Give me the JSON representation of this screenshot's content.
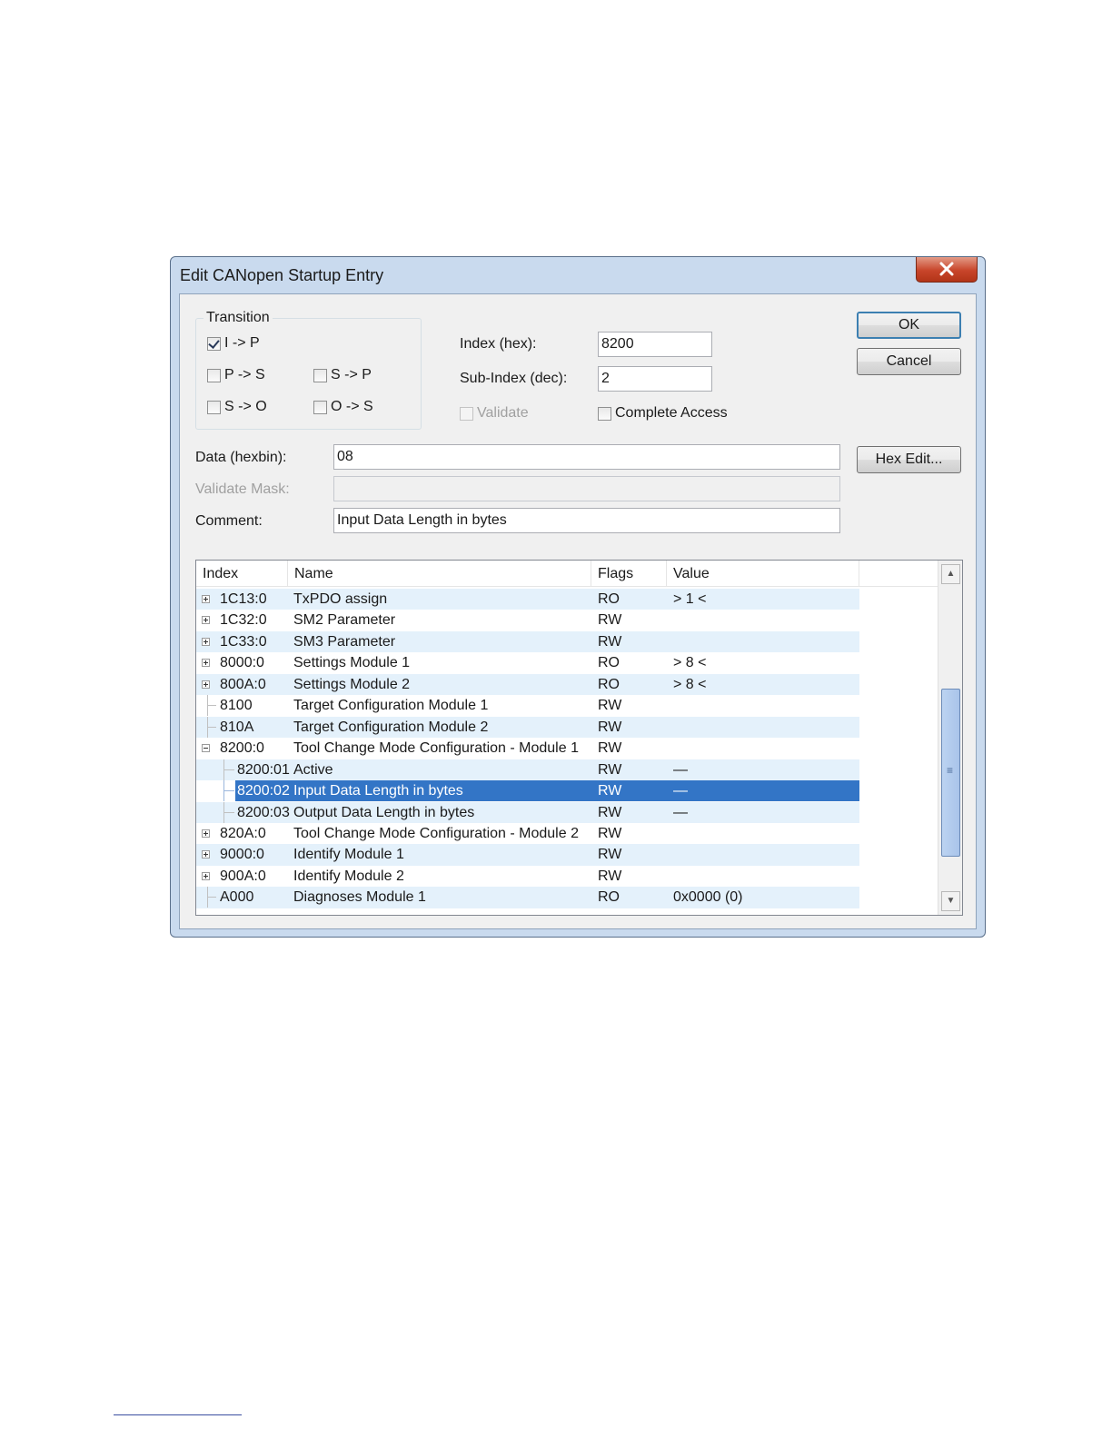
{
  "dialog": {
    "title": "Edit CANopen Startup Entry"
  },
  "transition": {
    "group_label": "Transition",
    "items": [
      {
        "label": "I -> P",
        "checked": true
      },
      {
        "label": "P -> S",
        "checked": false
      },
      {
        "label": "S -> P",
        "checked": false
      },
      {
        "label": "S -> O",
        "checked": false
      },
      {
        "label": "O -> S",
        "checked": false
      }
    ]
  },
  "fields": {
    "index_label": "Index (hex):",
    "index_value": "8200",
    "subindex_label": "Sub-Index (dec):",
    "subindex_value": "2",
    "validate_label": "Validate",
    "complete_access_label": "Complete Access",
    "data_label": "Data (hexbin):",
    "data_value": "08",
    "validate_mask_label": "Validate Mask:",
    "validate_mask_value": "",
    "comment_label": "Comment:",
    "comment_value": "Input Data Length in bytes"
  },
  "buttons": {
    "ok": "OK",
    "cancel": "Cancel",
    "hex_edit": "Hex Edit..."
  },
  "list": {
    "columns": [
      "Index",
      "Name",
      "Flags",
      "Value"
    ],
    "rows": [
      {
        "index": "1C13:0",
        "name": "TxPDO assign",
        "flags": "RO",
        "value": "> 1 <",
        "expander": "plus",
        "indent": 0
      },
      {
        "index": "1C32:0",
        "name": "SM2 Parameter",
        "flags": "RW",
        "value": "",
        "expander": "plus",
        "indent": 0
      },
      {
        "index": "1C33:0",
        "name": "SM3 Parameter",
        "flags": "RW",
        "value": "",
        "expander": "plus",
        "indent": 0
      },
      {
        "index": "8000:0",
        "name": "Settings Module 1",
        "flags": "RO",
        "value": "> 8 <",
        "expander": "plus",
        "indent": 0
      },
      {
        "index": "800A:0",
        "name": "Settings Module 2",
        "flags": "RO",
        "value": "> 8 <",
        "expander": "plus",
        "indent": 0
      },
      {
        "index": "8100",
        "name": "Target Configuration Module 1",
        "flags": "RW",
        "value": "",
        "expander": "none",
        "indent": 0
      },
      {
        "index": "810A",
        "name": "Target Configuration Module 2",
        "flags": "RW",
        "value": "",
        "expander": "none",
        "indent": 0
      },
      {
        "index": "8200:0",
        "name": "Tool Change Mode Configuration - Module 1",
        "flags": "RW",
        "value": "",
        "expander": "minus",
        "indent": 0
      },
      {
        "index": "8200:01",
        "name": "Active",
        "flags": "RW",
        "value": "—",
        "expander": "none",
        "indent": 1
      },
      {
        "index": "8200:02",
        "name": "Input Data Length in bytes",
        "flags": "RW",
        "value": "—",
        "expander": "none",
        "indent": 1,
        "selected": true
      },
      {
        "index": "8200:03",
        "name": "Output Data Length in bytes",
        "flags": "RW",
        "value": "—",
        "expander": "none",
        "indent": 1
      },
      {
        "index": "820A:0",
        "name": "Tool Change Mode Configuration - Module 2",
        "flags": "RW",
        "value": "",
        "expander": "plus",
        "indent": 0
      },
      {
        "index": "9000:0",
        "name": "Identify Module 1",
        "flags": "RW",
        "value": "",
        "expander": "plus",
        "indent": 0
      },
      {
        "index": "900A:0",
        "name": "Identify Module 2",
        "flags": "RW",
        "value": "",
        "expander": "plus",
        "indent": 0
      },
      {
        "index": "A000",
        "name": "Diagnoses Module 1",
        "flags": "RO",
        "value": "0x0000 (0)",
        "expander": "none",
        "indent": 0
      }
    ]
  },
  "colors": {
    "selection": "#3375c6",
    "alt_row": "#e4f1fb",
    "frame": "#c9daee"
  }
}
